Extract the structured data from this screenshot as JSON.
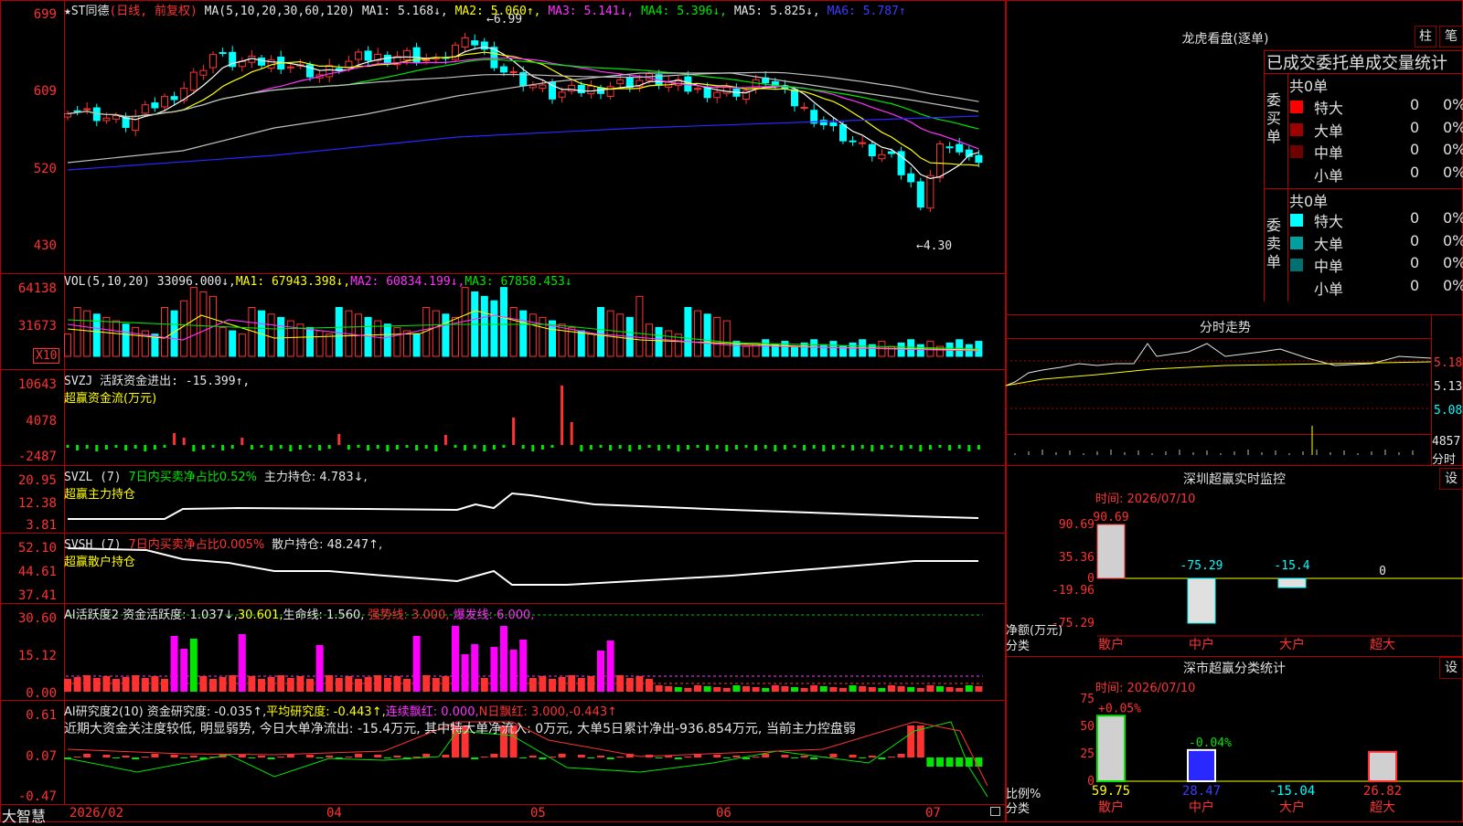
{
  "app": {
    "brand": "大智慧",
    "stock_name": "★ST同德",
    "mode": "(日线, 前复权)"
  },
  "main": {
    "ma_params": "MA(5,10,20,30,60,120)",
    "ma_labels": [
      "MA1: 5.168↓,",
      "MA2: 5.060↑,",
      "MA3: 5.141↓,",
      "MA4: 5.396↓,",
      "MA5: 5.825↓,",
      "MA6: 5.787↑"
    ],
    "y_ticks": [
      "699",
      "609",
      "520",
      "430"
    ],
    "annot_high": "6.99",
    "annot_low": "4.30",
    "colors": {
      "up": "#ff3232",
      "down": "#00ffff",
      "ma1": "#ffffff",
      "ma2": "#ffff00",
      "ma3": "#ff32ff",
      "ma4": "#00e600",
      "ma5": "#c0c0c0",
      "ma6": "#2828ff"
    }
  },
  "vol": {
    "header": "VOL(5,10,20)",
    "val": "33096.000↓,",
    "ma_labels": [
      "MA1: 67943.398↓,",
      "MA2: 60834.199↓,",
      "MA3: 67858.453↓"
    ],
    "y_ticks": [
      "64138",
      "31673"
    ],
    "unit": "X10"
  },
  "svzj": {
    "header": "SVZJ",
    "line1": "活跃资金进出: -15.399↑,",
    "line2": "超赢资金流(万元)",
    "y_ticks": [
      "10643",
      "4078",
      "-2487"
    ]
  },
  "svzl": {
    "header": "SVZL (7)",
    "a": "7日内买卖净占比0.52%",
    "b": "主力持仓: 4.783↓,",
    "line2": "超赢主力持仓",
    "y_ticks": [
      "20.95",
      "12.38",
      "3.81"
    ]
  },
  "svsh": {
    "header": "SVSH (7)",
    "a": "7日内买卖净占比0.005%",
    "b": "散户持仓: 48.247↑,",
    "line2": "超赢散户持仓",
    "y_ticks": [
      "52.10",
      "44.61",
      "37.41"
    ]
  },
  "ai_active": {
    "title": "AI活跃度2",
    "a": "资金活跃度: 1.037↓,",
    "b": "30.601,",
    "c": "生命线: 1.560,",
    "d": "强势线: 3.000,",
    "e": "爆发线: 6.000,",
    "y_ticks": [
      "30.60",
      "15.12",
      "0.00"
    ]
  },
  "ai_research": {
    "title": "AI研究度2(10)",
    "a": "资金研究度: -0.035↑,",
    "b": "平均研究度: -0.443↑,",
    "c": "连续飘红: 0.000,",
    "d": "N日飘红: 3.000,",
    "e": "-0.443↑",
    "comment": "近期大资金关注度较低, 明显弱势, 今日大单净流出: -15.4万元, 其中特大单净流入: 0万元, 大单5日累计净出-936.854万元, 当前主力控盘弱",
    "y_ticks": [
      "0.61",
      "0.07",
      "-0.47"
    ]
  },
  "x_axis": {
    "labels": [
      "2026/02",
      "04",
      "05",
      "06",
      "07"
    ]
  },
  "dragon": {
    "title": "龙虎看盘(逐单)",
    "btn_bar": "柱",
    "btn_pen": "笔",
    "subtitle": "已成交委托单成交量统计",
    "buy": {
      "label": "委买单",
      "total": "共0单",
      "rows": [
        {
          "name": "特大",
          "count": "0",
          "pct": "0%",
          "color": "#ff0000"
        },
        {
          "name": "大单",
          "count": "0",
          "pct": "0%",
          "color": "#a00000"
        },
        {
          "name": "中单",
          "count": "0",
          "pct": "0%",
          "color": "#6e0000"
        },
        {
          "name": "小单",
          "count": "0",
          "pct": "0%",
          "color": "#000000"
        }
      ]
    },
    "sell": {
      "label": "委卖单",
      "total": "共0单",
      "rows": [
        {
          "name": "特大",
          "count": "0",
          "pct": "0%",
          "color": "#00ffff"
        },
        {
          "name": "大单",
          "count": "0",
          "pct": "0%",
          "color": "#00a0a0"
        },
        {
          "name": "中单",
          "count": "0",
          "pct": "0%",
          "color": "#007070"
        },
        {
          "name": "小单",
          "count": "0",
          "pct": "0%",
          "color": "#000000"
        }
      ]
    }
  },
  "intraday": {
    "title": "分时走势",
    "y_ticks": [
      "5.18",
      "5.13",
      "5.08"
    ],
    "vol_tick": "4857",
    "vol_unit": "分时"
  },
  "sz_monitor": {
    "title": "深圳超赢实时监控",
    "btn": "设",
    "time": "时间: 2026/07/10",
    "y_ticks": [
      "90.69",
      "35.36",
      "0",
      "-19.96",
      "-75.29"
    ],
    "ylabel": "净额(万元)",
    "xlabel": "分类",
    "chart_data": {
      "type": "bar",
      "categories": [
        "散户",
        "中户",
        "大户",
        "超大"
      ],
      "values": [
        90.69,
        -75.29,
        -15.4,
        0
      ],
      "value_labels": [
        "90.69",
        "-75.29",
        "-15.4",
        "0"
      ],
      "ylim": [
        -75.29,
        90.69
      ]
    }
  },
  "sz_class": {
    "title": "深市超赢分类统计",
    "btn": "设",
    "time": "时间: 2026/07/10",
    "y_ticks": [
      "75",
      "50",
      "25",
      "0"
    ],
    "ylabel": "比例%",
    "xlabel": "分类",
    "chart_data": {
      "type": "bar",
      "categories": [
        "散户",
        "中户",
        "大户",
        "超大"
      ],
      "values": [
        59.75,
        28.47,
        0,
        26.82
      ],
      "top_labels": [
        "+0.05%",
        "-0.04%",
        "",
        ""
      ],
      "bottom_labels": [
        "59.75",
        "28.47",
        "-15.04",
        "26.82"
      ],
      "ylim": [
        0,
        75
      ]
    }
  }
}
